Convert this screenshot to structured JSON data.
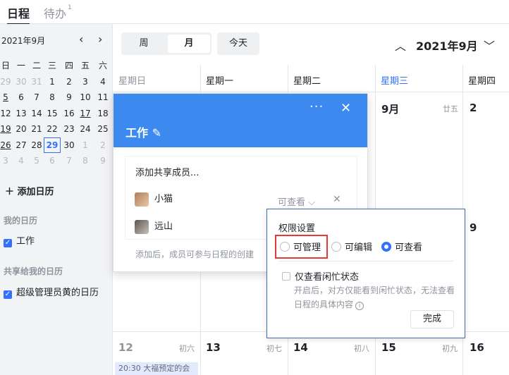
{
  "tabs": {
    "schedule": "日程",
    "todo": "待办",
    "todo_count": "1"
  },
  "mini_calendar": {
    "month_label": "2021年9月",
    "weekdays": [
      "日",
      "一",
      "二",
      "三",
      "四",
      "五",
      "六"
    ],
    "weeks": [
      [
        "29",
        "30",
        "31",
        "1",
        "2",
        "3",
        "4"
      ],
      [
        "5",
        "6",
        "7",
        "8",
        "9",
        "10",
        "11"
      ],
      [
        "12",
        "13",
        "14",
        "15",
        "16",
        "17",
        "18"
      ],
      [
        "19",
        "20",
        "21",
        "22",
        "23",
        "24",
        "25"
      ],
      [
        "26",
        "27",
        "28",
        "29",
        "30",
        "1",
        "2"
      ],
      [
        "3",
        "4",
        "5",
        "6",
        "7",
        "8",
        "9"
      ]
    ],
    "today": "29"
  },
  "sidebar": {
    "add_calendar": "添加日历",
    "my_calendars_title": "我的日历",
    "my_calendars": [
      "工作"
    ],
    "shared_title": "共享给我的日历",
    "shared": [
      "超级管理员黄的日历"
    ]
  },
  "toolbar": {
    "week": "周",
    "month": "月",
    "today": "今天",
    "current_month": "2021年9月"
  },
  "week_header": [
    "星期日",
    "星期一",
    "星期二",
    "星期三",
    "星期四"
  ],
  "grid": {
    "row1": [
      {
        "day": "9月",
        "lunar": "廿五"
      },
      {
        "day": "2",
        "lunar": ""
      }
    ],
    "row2_day": "9",
    "row3": [
      {
        "day": "12",
        "lunar": "初六"
      },
      {
        "day": "13",
        "lunar": "初七"
      },
      {
        "day": "14",
        "lunar": "初八"
      },
      {
        "day": "15",
        "lunar": "初九"
      },
      {
        "day": "16",
        "lunar": ""
      }
    ],
    "event": "20:30 大福预定的会"
  },
  "popup": {
    "title": "工作",
    "add_member": "添加共享成员...",
    "members": [
      {
        "name": "小猫",
        "permission": "可查看"
      },
      {
        "name": "远山"
      }
    ],
    "note": "添加后，成员可参与日程的创建"
  },
  "permission_panel": {
    "title": "权限设置",
    "options": [
      "可管理",
      "可编辑",
      "可查看"
    ],
    "selected": "可查看",
    "busy_only": "仅查看闲忙状态",
    "busy_desc": "开启后，对方仅能看到闲忙状态，无法查看日程的具体内容",
    "done": "完成"
  },
  "colors": {
    "accent": "#3370ff",
    "popup_header": "#3c8af0",
    "highlight_box": "#e53935"
  }
}
